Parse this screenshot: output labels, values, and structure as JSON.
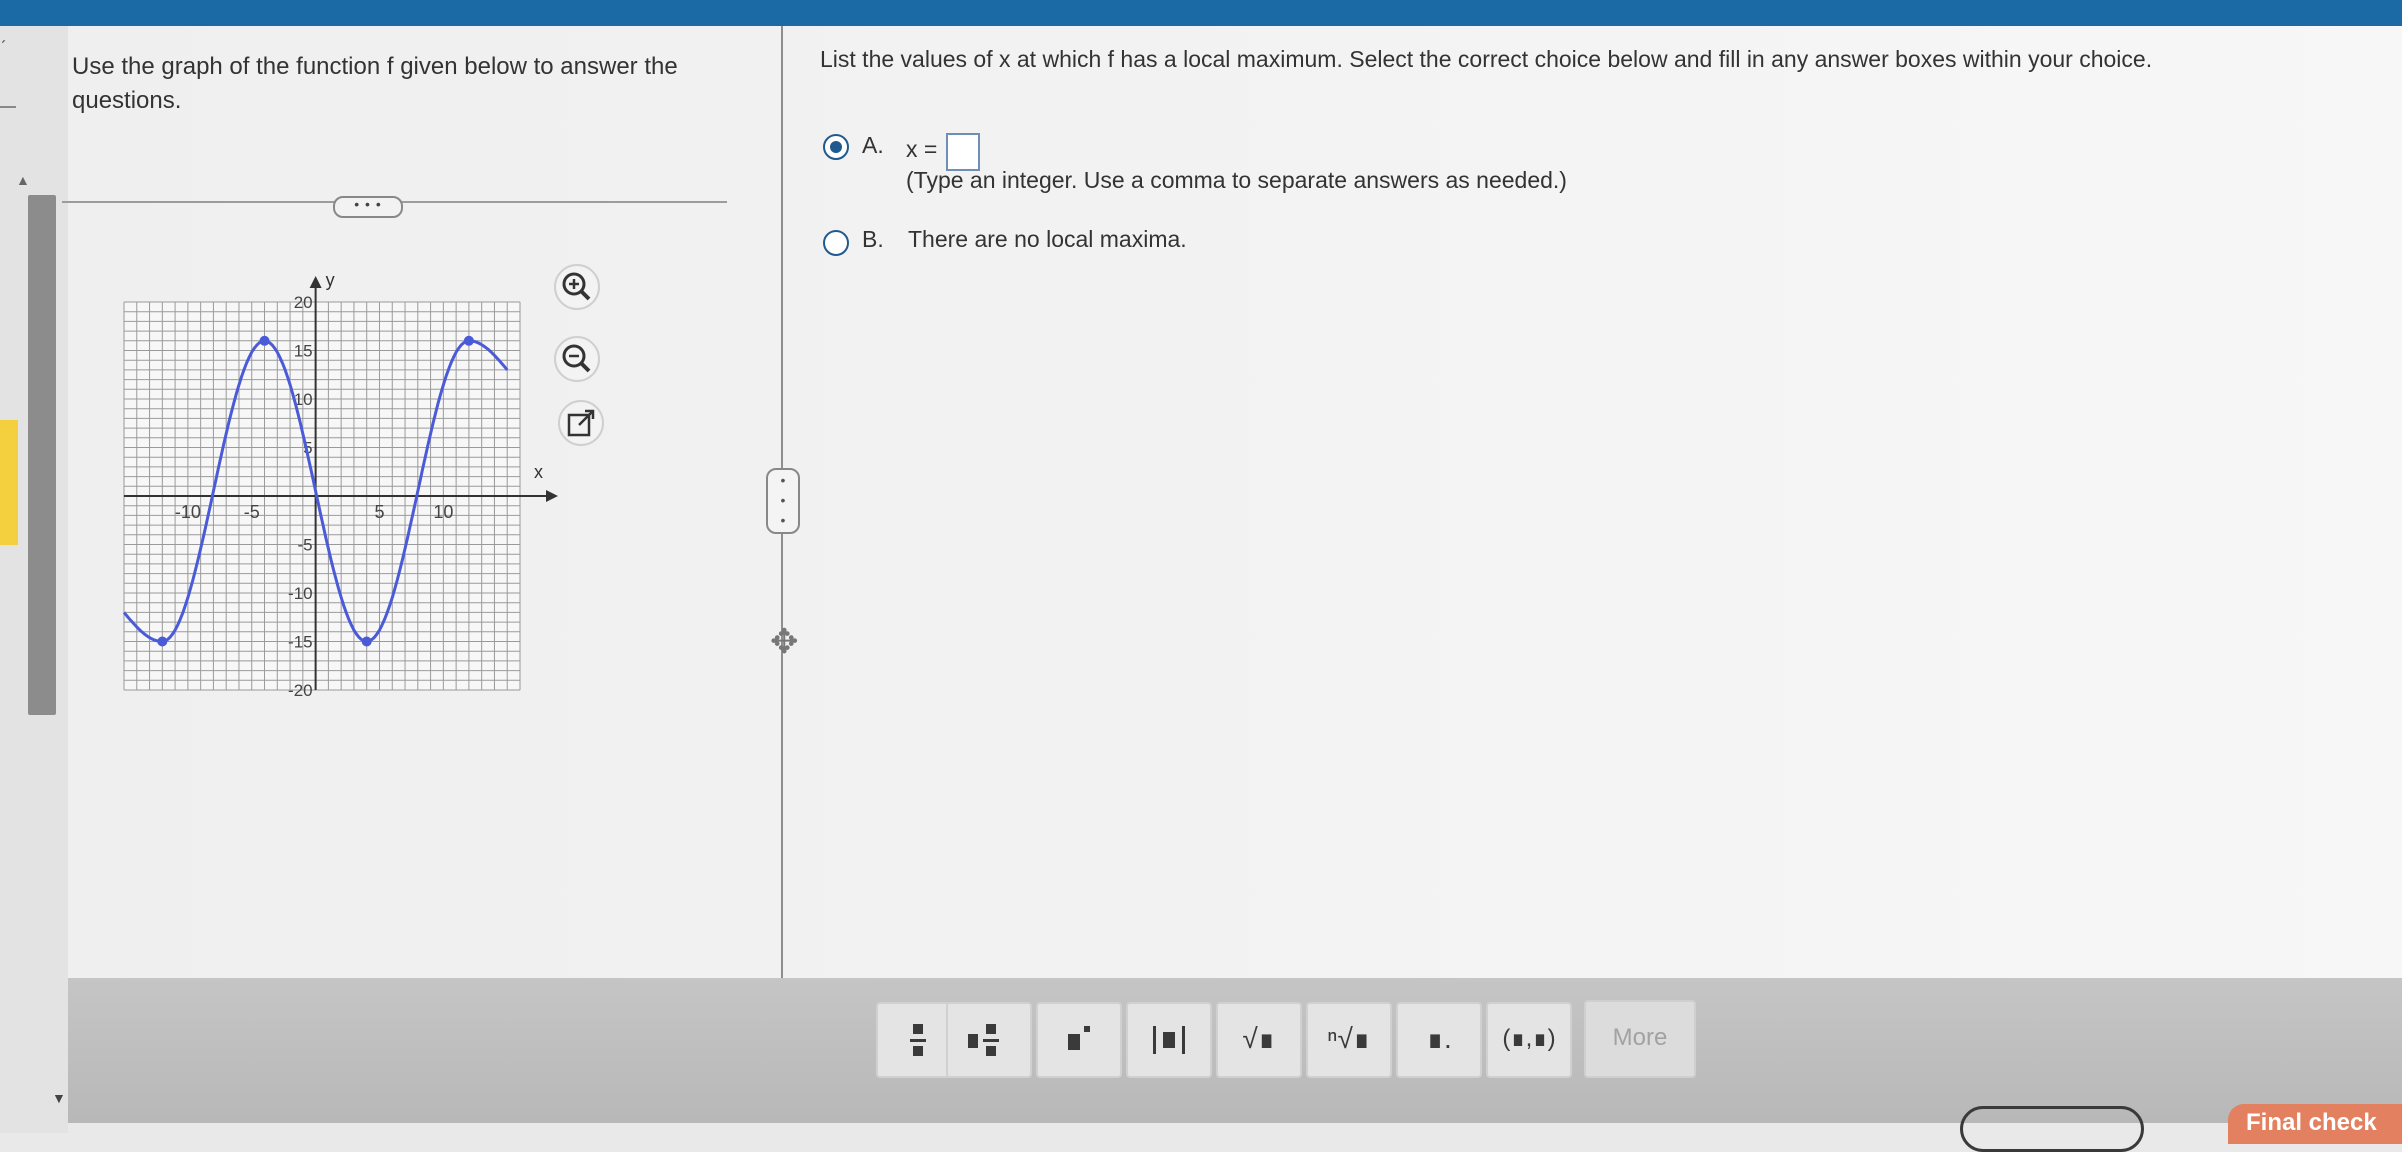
{
  "question": {
    "left_text": "Use the graph of the function f given below to answer the questions.",
    "right_text": "List the values of x at which f has a local maximum. Select the correct choice below and fill in any answer boxes within your choice."
  },
  "choices": {
    "a_letter": "A.",
    "a_prefix": "x =",
    "a_value": "",
    "a_hint": "(Type an integer. Use a comma to separate answers as needed.)",
    "b_letter": "B.",
    "b_text": "There are no local maxima.",
    "selected": "A"
  },
  "graph": {
    "x_axis_label": "x",
    "y_axis_label": "y",
    "x_ticks": [
      "-10",
      "-5",
      "5",
      "10"
    ],
    "y_ticks": [
      "20",
      "15",
      "10",
      "5",
      "-5",
      "-10",
      "-15",
      "-20"
    ],
    "x_range": [
      -15,
      16
    ],
    "y_range": [
      -20,
      20
    ],
    "curve_color": "#4b5bd8",
    "grid_color": "#9a9a9a",
    "key_points": [
      {
        "x": -12,
        "y": -15
      },
      {
        "x": -4,
        "y": 16
      },
      {
        "x": 4,
        "y": -15
      },
      {
        "x": 12,
        "y": 16
      }
    ],
    "curve_left_end": [
      -15,
      -12
    ],
    "curve_right_end": [
      15,
      13
    ]
  },
  "tools": {
    "zoom_in": "zoom-in-icon",
    "zoom_out": "zoom-out-icon",
    "popout": "external-link-icon"
  },
  "toolbar": {
    "fraction": "fraction-icon",
    "mixed_number": "mixed-number-icon",
    "exponent": "exponent-icon",
    "absolute_value": "absolute-value-icon",
    "sqrt": "√∎",
    "nth_root": "ⁿ√∎",
    "decimal": "∎.",
    "ordered_pair": "(∎,∎)",
    "more": "More"
  },
  "footer": {
    "final_check": "Final check"
  }
}
